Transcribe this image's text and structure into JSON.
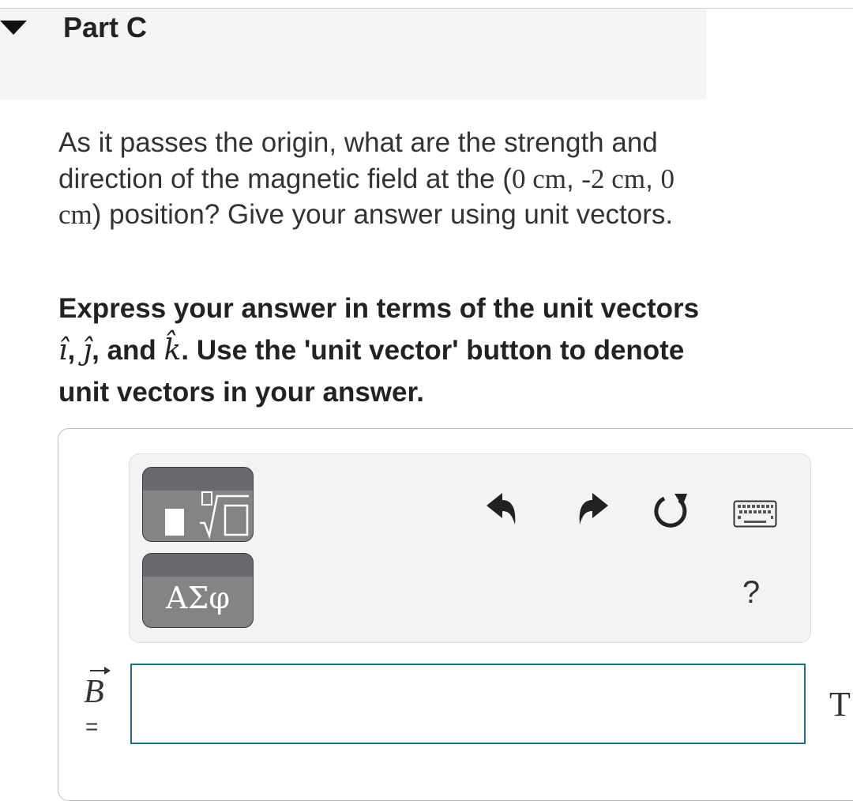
{
  "part": {
    "title": "Part C",
    "collapse_icon": "triangle-down-icon"
  },
  "question": {
    "text_a": "As it passes the origin, what are the strength and direction of the magnetic field at the (",
    "coord1": "0 cm",
    "sep1": ", ",
    "coord2": "-2 cm",
    "sep2": ", ",
    "coord3": "0 cm",
    "text_b": ") position? Give your answer using unit vectors."
  },
  "instructions": {
    "text_a": "Express your answer in terms of the unit vectors ",
    "vec_i": "î",
    "sep1": ", ",
    "vec_j": "ĵ",
    "sep2": ", and ",
    "vec_k": "k̂",
    "text_b": ". Use the 'unit vector' button to denote unit vectors in your answer."
  },
  "toolbar": {
    "templates_icon": "templates-icon",
    "greek_symbols_label": "ΑΣφ",
    "undo_icon": "undo-icon",
    "redo_icon": "redo-icon",
    "reset_icon": "reset-icon",
    "keyboard_icon": "keyboard-icon",
    "help_label": "?"
  },
  "answer": {
    "variable": "B",
    "equals": "=",
    "value": "",
    "units": "T"
  },
  "colors": {
    "header_bg": "#f4f4f4",
    "toolbar_bg": "#f3f3f3",
    "button_dark": "#696a6d",
    "input_border": "#1a6d84"
  }
}
